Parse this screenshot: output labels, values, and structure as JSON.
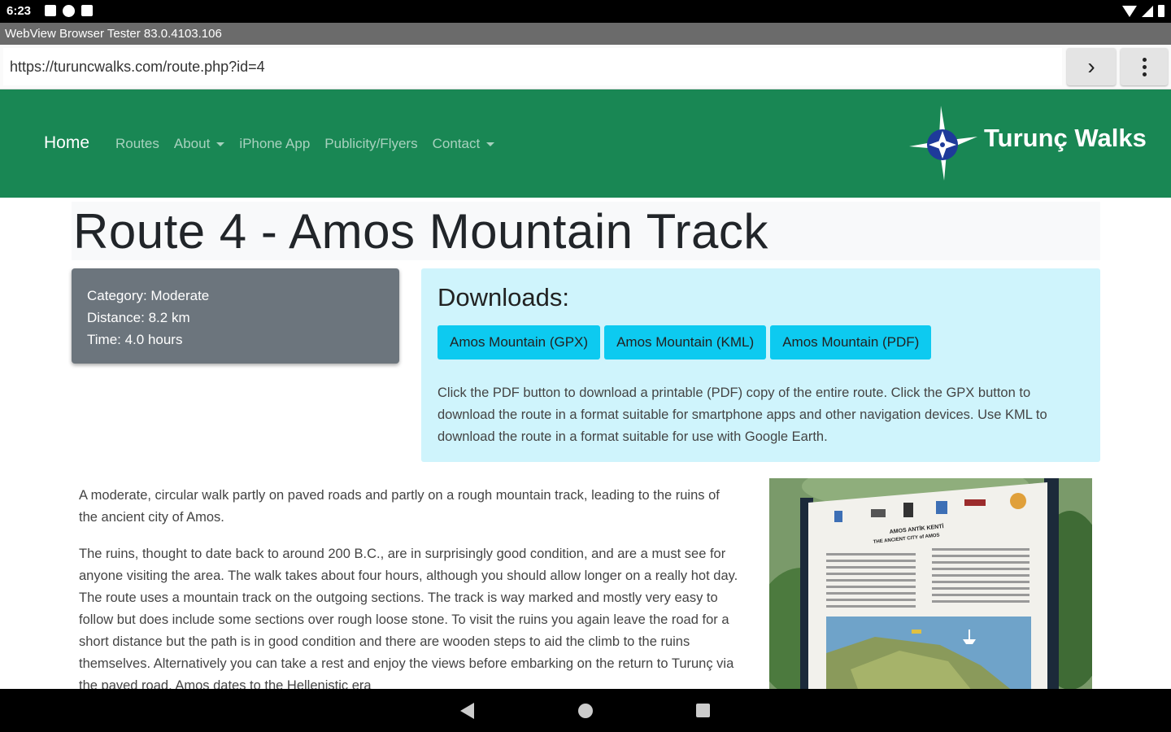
{
  "statusbar": {
    "time": "6:23"
  },
  "app": {
    "title": "WebView Browser Tester 83.0.4103.106"
  },
  "browser": {
    "url": "https://turuncwalks.com/route.php?id=4",
    "go_label": "›"
  },
  "nav": {
    "home": "Home",
    "items": [
      {
        "label": "Routes",
        "dropdown": false
      },
      {
        "label": "About",
        "dropdown": true
      },
      {
        "label": "iPhone App",
        "dropdown": false
      },
      {
        "label": "Publicity/Flyers",
        "dropdown": false
      },
      {
        "label": "Contact",
        "dropdown": true
      }
    ],
    "brand": "Turunç Walks"
  },
  "route": {
    "title": "Route 4 - Amos Mountain Track",
    "category": "Category: Moderate",
    "distance": "Distance: 8.2 km",
    "time": "Time: 4.0 hours"
  },
  "downloads": {
    "heading": "Downloads:",
    "buttons": [
      "Amos Mountain (GPX)",
      "Amos Mountain (KML)",
      "Amos Mountain (PDF)"
    ],
    "description": "Click the PDF button to download a printable (PDF) copy of the entire route. Click the GPX button to download the route in a format suitable for smartphone apps and other navigation devices. Use KML to download the route in a format suitable for use with Google Earth."
  },
  "body": {
    "p1": "A moderate, circular walk partly on paved roads and partly on a rough mountain track, leading to the ruins of the ancient city of Amos.",
    "p2": "The ruins, thought to date back to around 200 B.C., are in surprisingly good condition, and are a must see for anyone visiting the area. The walk takes about four hours, although you should allow longer on a really hot day. The route uses a mountain track on the outgoing sections. The track is way marked and mostly very easy to follow but does include some sections over rough loose stone. To visit the ruins you again leave the road for a short distance but the path is in good condition and there are wooden steps to aid the climb to the ruins themselves. Alternatively you can take a rest and enjoy the views before embarking on the return to Turunç via the paved road. Amos dates to the Hellenistic era"
  },
  "photo": {
    "sign_title": "AMOS ANTİK KENTİ",
    "sign_subtitle": "THE ANCIENT CITY of AMOS"
  },
  "colors": {
    "navbar": "#198754",
    "info_card": "#6c757d",
    "downloads_bg": "#cff4fc",
    "download_button": "#0dcaf0"
  }
}
